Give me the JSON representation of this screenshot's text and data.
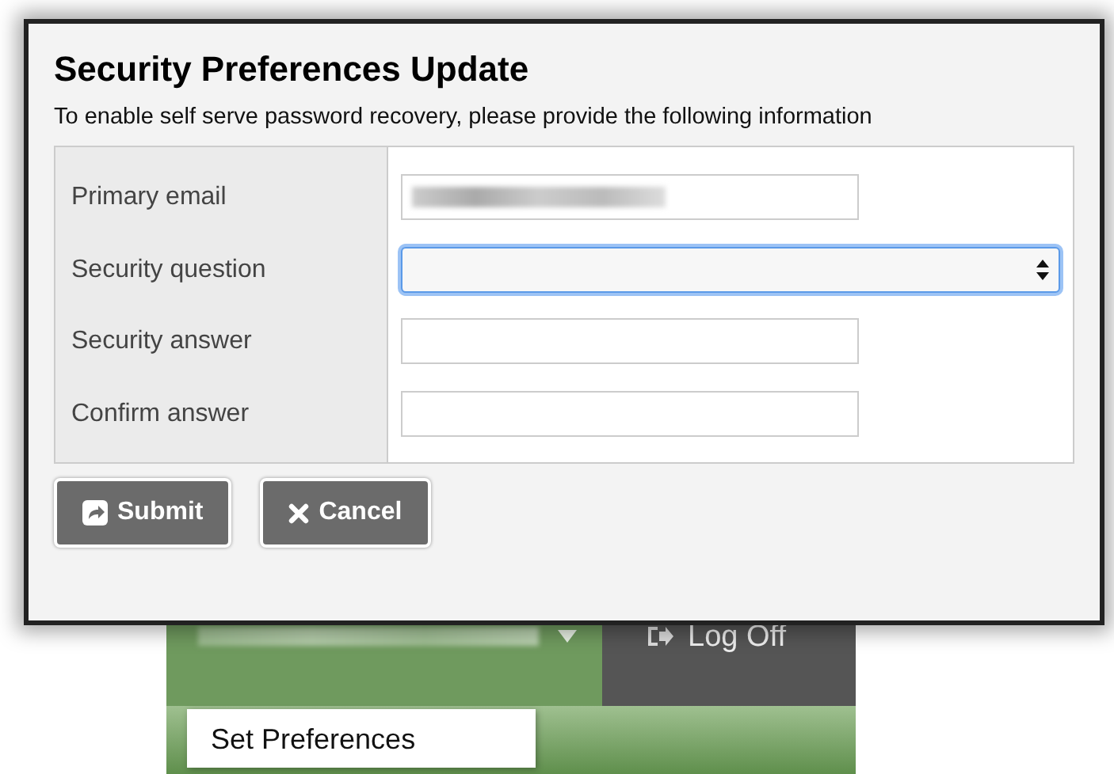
{
  "dialog": {
    "title": "Security Preferences Update",
    "description": "To enable self serve password recovery, please provide the following information",
    "fields": [
      {
        "label": "Primary email",
        "kind": "text",
        "redacted": true,
        "focused": false
      },
      {
        "label": "Security question",
        "kind": "select",
        "redacted": false,
        "focused": true
      },
      {
        "label": "Security answer",
        "kind": "text",
        "redacted": false,
        "focused": false
      },
      {
        "label": "Confirm answer",
        "kind": "text",
        "redacted": false,
        "focused": false
      }
    ],
    "buttons": [
      {
        "label": "Submit",
        "kind": "submit"
      },
      {
        "label": "Cancel",
        "kind": "cancel"
      }
    ]
  },
  "background": {
    "user_menu": {
      "redacted": true
    },
    "logoff": "Log Off",
    "menu_items": [
      "Set Preferences"
    ]
  }
}
